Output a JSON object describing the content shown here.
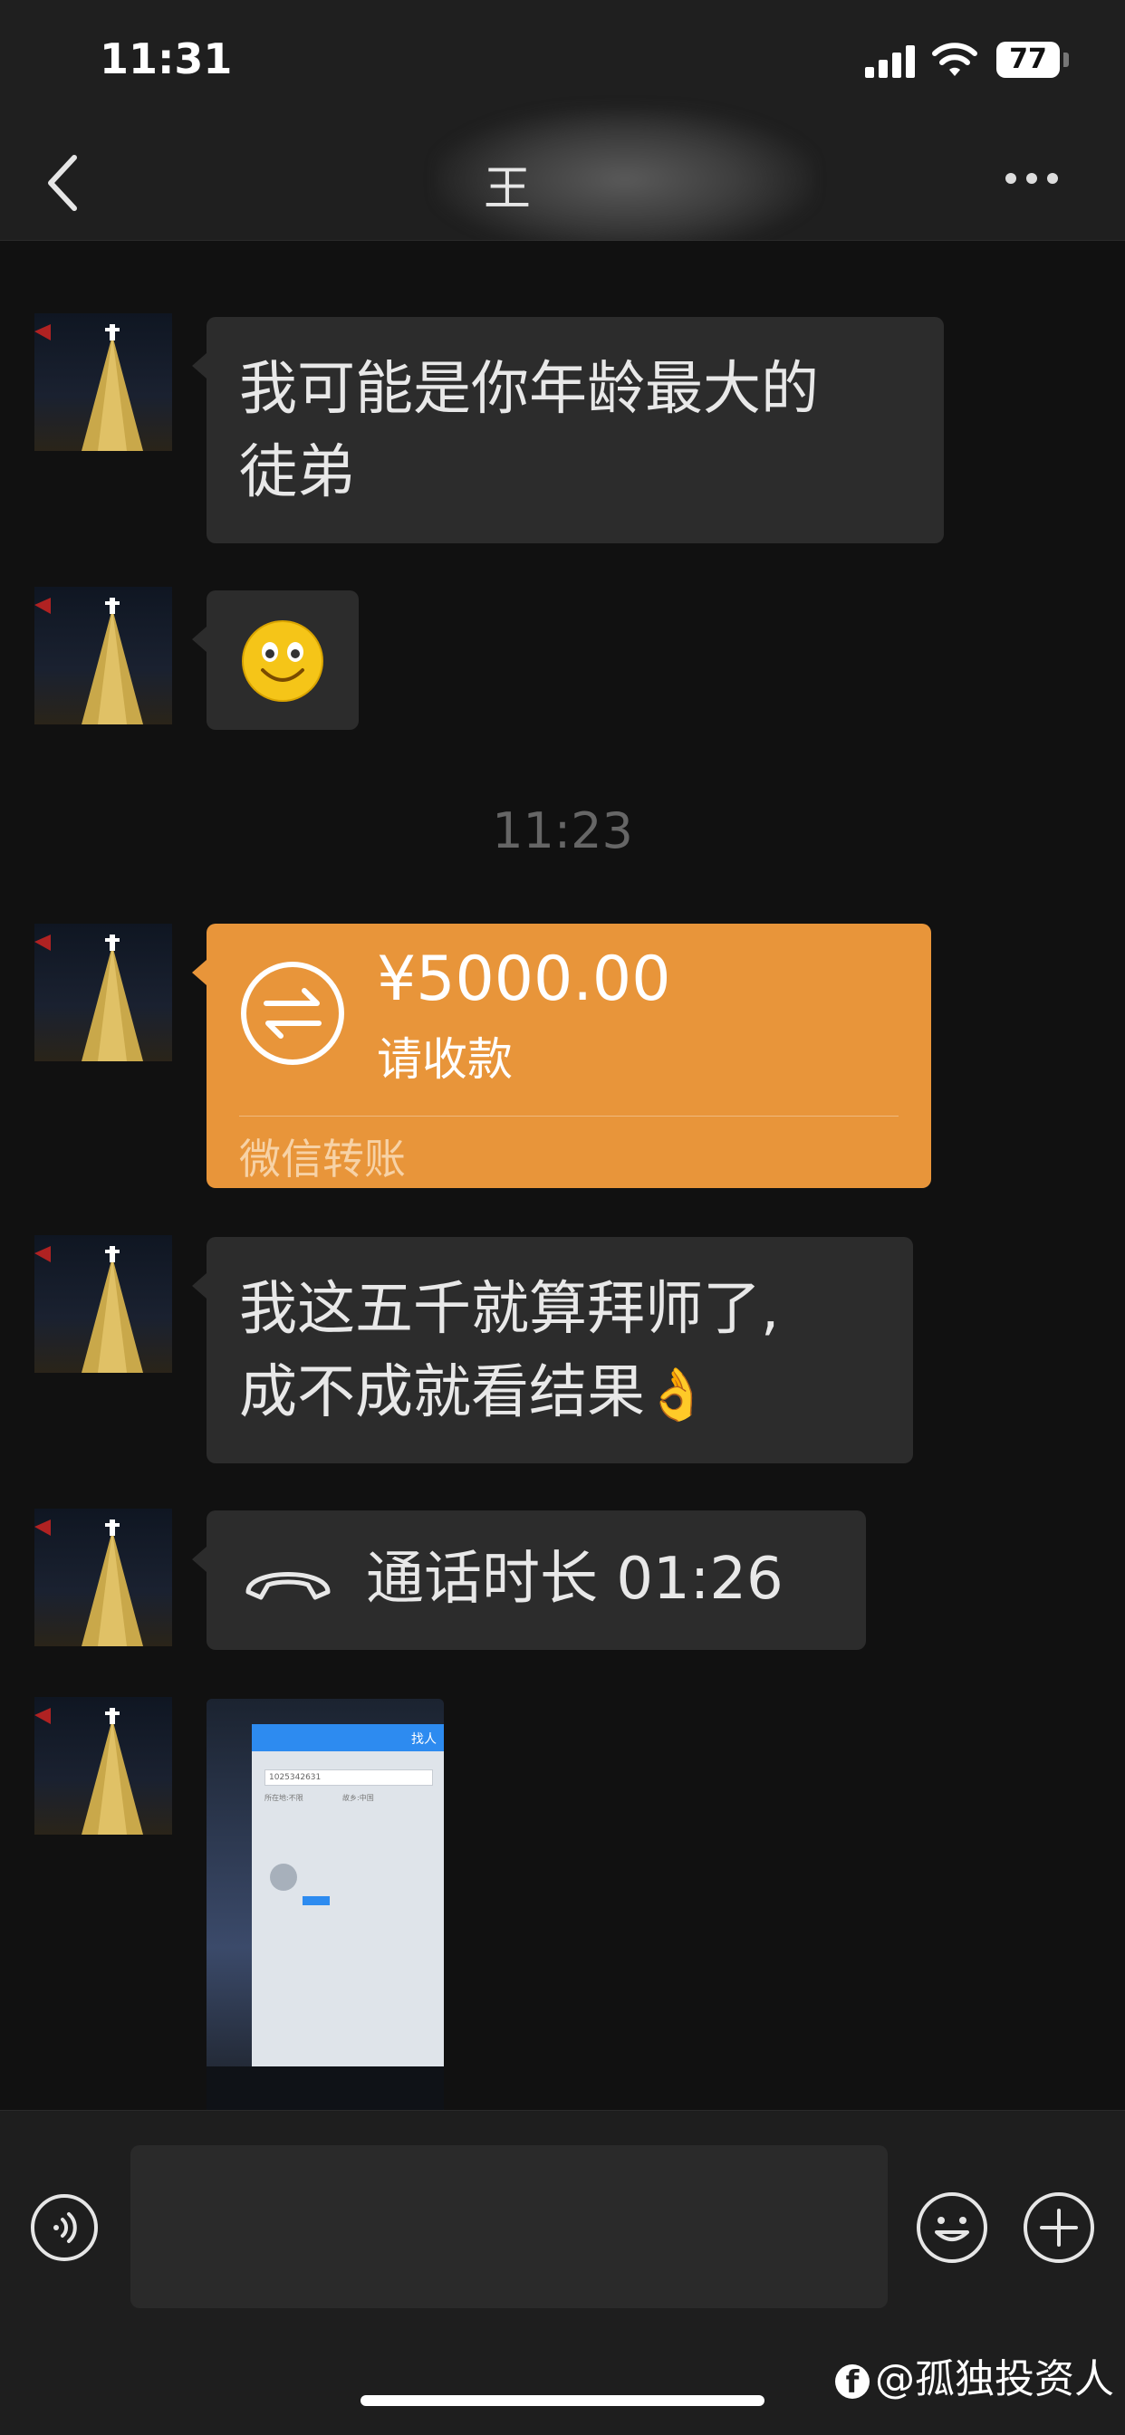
{
  "status_bar": {
    "time": "11:31",
    "battery": "77"
  },
  "header": {
    "title": "王"
  },
  "messages": [
    {
      "type": "text",
      "line1": "我可能是你年龄最大的",
      "line2": "徒弟"
    },
    {
      "type": "emoji",
      "emoji": "smile"
    },
    {
      "type": "timestamp",
      "text": "11:23"
    },
    {
      "type": "transfer",
      "amount": "¥5000.00",
      "status": "请收款",
      "label": "微信转账"
    },
    {
      "type": "text",
      "line1": "我这五千就算拜师了,",
      "line2": "成不成就看结果",
      "emoji": "👌"
    },
    {
      "type": "call",
      "text": "通话时长 01:26"
    },
    {
      "type": "image",
      "screen_title": "找人",
      "screen_field": "1025342631",
      "screen_row": "所在地:不限",
      "screen_row2": "故乡:中国"
    }
  ],
  "watermark": {
    "text": "@孤独投资人"
  },
  "colors": {
    "transfer": "#e8953a",
    "bubble": "#2c2c2c",
    "background": "#111111"
  },
  "icons": [
    "back-icon",
    "more-icon",
    "transfer-icon",
    "call-icon",
    "voice-icon",
    "emoji-icon",
    "plus-icon"
  ]
}
